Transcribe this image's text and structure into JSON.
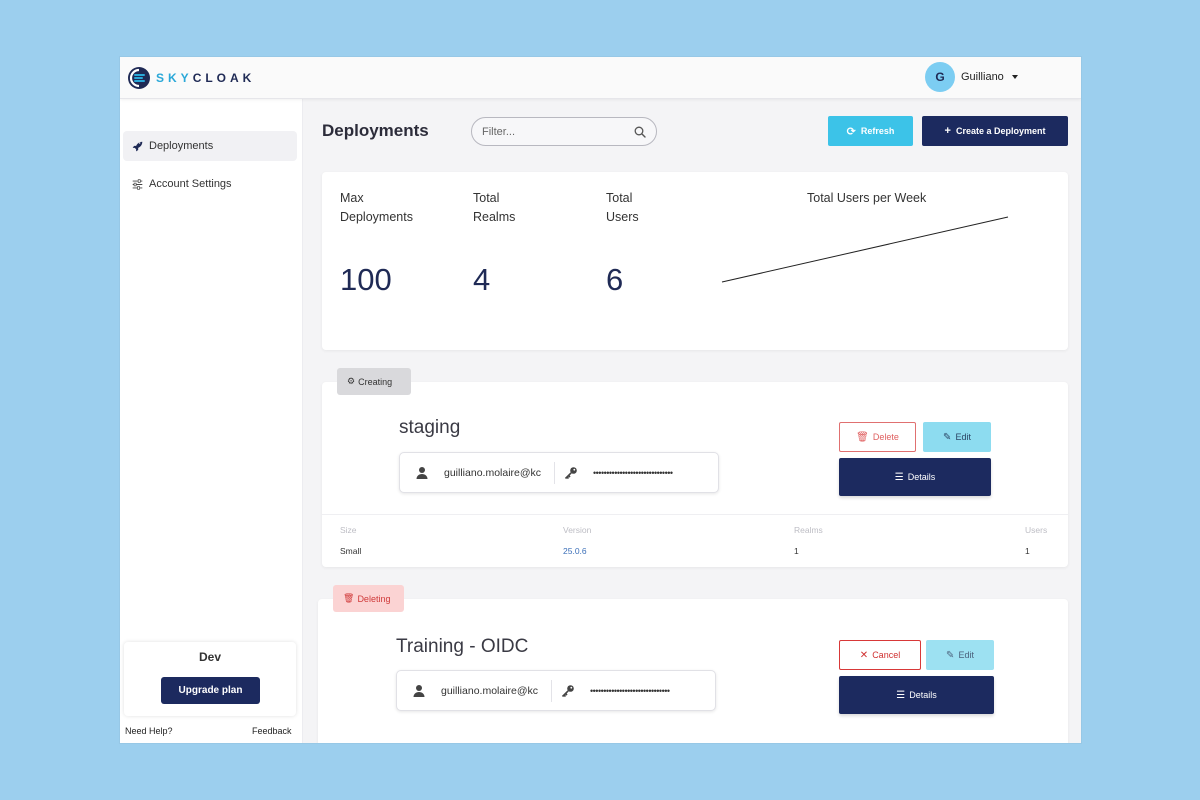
{
  "app": {
    "brand_prefix": "SKY",
    "brand_suffix": "CLOAK",
    "accent_color": "#3cc3e8",
    "primary_color": "#1c2a5f"
  },
  "user": {
    "initial": "G",
    "name": "Guilliano"
  },
  "sidebar": {
    "items": [
      {
        "label": "Deployments",
        "icon": "rocket-icon",
        "active": true
      },
      {
        "label": "Account Settings",
        "icon": "sliders-icon",
        "active": false
      }
    ],
    "plan_name": "Dev",
    "upgrade_label": "Upgrade plan",
    "help_label": "Need Help?",
    "feedback_label": "Feedback"
  },
  "main": {
    "title": "Deployments",
    "filter_placeholder": "Filter...",
    "refresh_label": "Refresh",
    "create_label": "Create a Deployment"
  },
  "stats": {
    "max_deployments_label": "Max Deployments",
    "max_deployments_value": "100",
    "total_realms_label": "Total Realms",
    "total_realms_value": "4",
    "total_users_label": "Total Users",
    "total_users_value": "6",
    "chart_title": "Total Users per Week"
  },
  "chart_data": {
    "type": "line",
    "title": "Total Users per Week",
    "series": [
      {
        "values": [
          0,
          6
        ]
      }
    ],
    "grid": false,
    "axes_visible": false
  },
  "deployments": [
    {
      "status": "Creating",
      "name": "staging",
      "username": "guilliano.molaire@kc",
      "password": "••••••••••••••••••••••••••••••",
      "delete_label": "Delete",
      "edit_label": "Edit",
      "details_label": "Details",
      "size_label": "Size",
      "size": "Small",
      "version_label": "Version",
      "version": "25.0.6",
      "realms_label": "Realms",
      "realms": "1",
      "users_label": "Users",
      "users": "1"
    },
    {
      "status": "Deleting",
      "name": "Training - OIDC",
      "username": "guilliano.molaire@kc",
      "password": "••••••••••••••••••••••••••••••",
      "cancel_label": "Cancel",
      "edit_label": "Edit",
      "details_label": "Details"
    }
  ]
}
